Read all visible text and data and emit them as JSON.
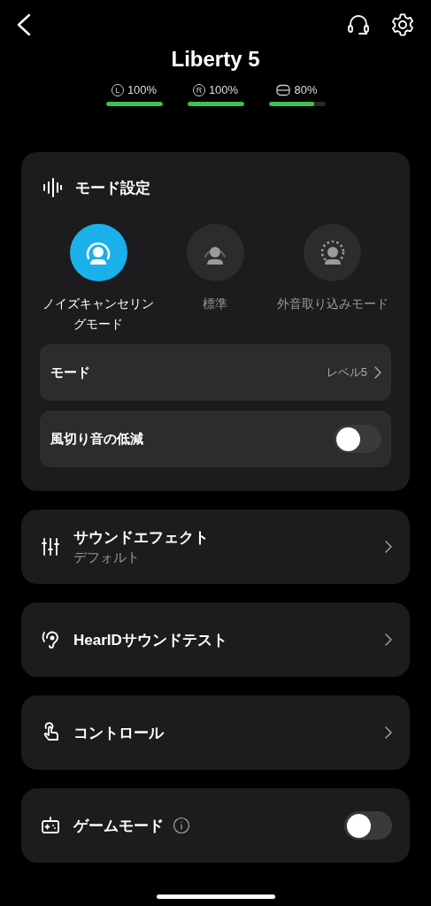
{
  "header": {
    "title": "Liberty 5"
  },
  "batteries": [
    {
      "kind": "left",
      "badge": "L",
      "text": "100%",
      "level": 1.0
    },
    {
      "kind": "right",
      "badge": "R",
      "text": "100%",
      "level": 1.0
    },
    {
      "kind": "case",
      "text": "80%",
      "level": 0.8
    }
  ],
  "mode_settings": {
    "title": "モード設定",
    "modes": [
      {
        "kind": "anc",
        "label": "ノイズキャンセリングモード",
        "selected": true
      },
      {
        "kind": "normal",
        "label": "標準",
        "selected": false
      },
      {
        "kind": "transparency",
        "label": "外音取り込みモード",
        "selected": false
      }
    ],
    "rows": [
      {
        "kind": "nav",
        "label": "モード",
        "value": "レベル5"
      },
      {
        "kind": "toggle",
        "label": "風切り音の低減",
        "on": false
      }
    ]
  },
  "menu": [
    {
      "kind": "nav",
      "title": "サウンドエフェクト",
      "subtitle": "デフォルト"
    },
    {
      "kind": "nav",
      "title": "HearIDサウンドテスト"
    },
    {
      "kind": "nav",
      "title": "コントロール"
    },
    {
      "kind": "toggle",
      "title": "ゲームモード",
      "info": true,
      "on": false
    }
  ]
}
